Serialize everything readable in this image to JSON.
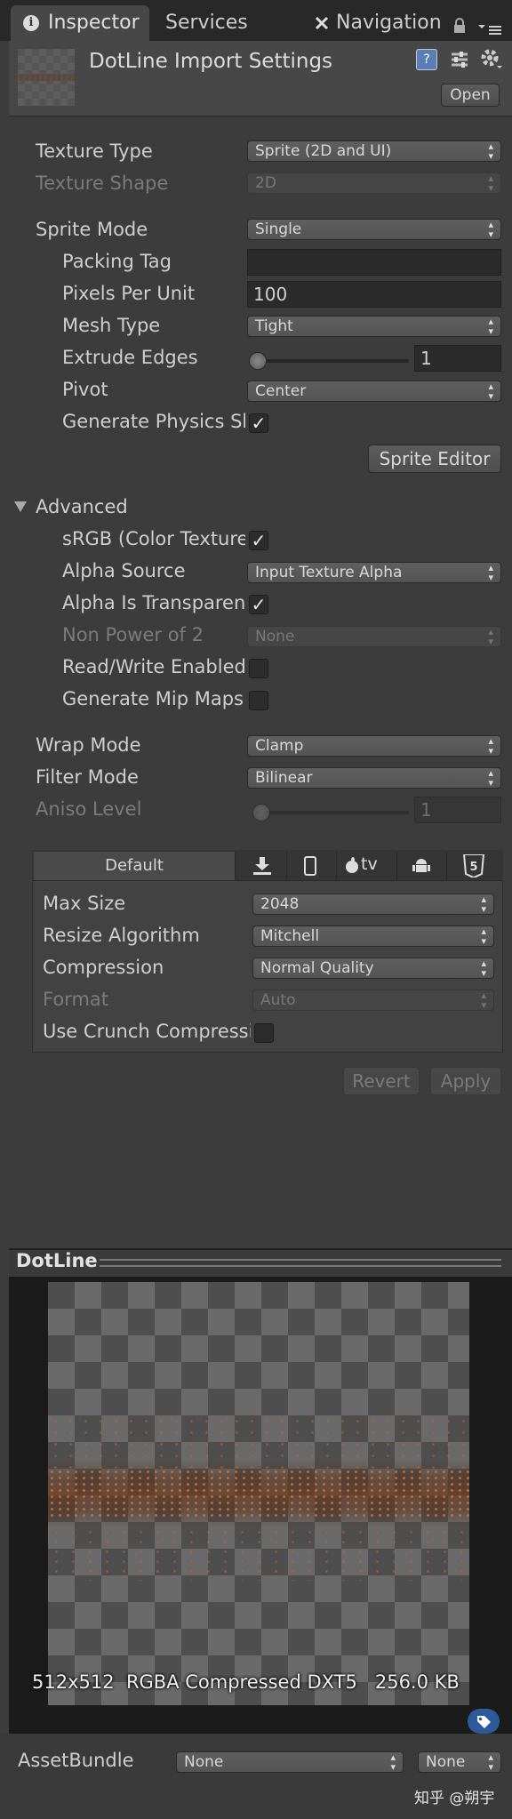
{
  "tabs": {
    "inspector": "Inspector",
    "services": "Services",
    "navigation": "Navigation"
  },
  "header": {
    "title": "DotLine Import Settings",
    "open_button": "Open"
  },
  "settings": {
    "texture_type": {
      "label": "Texture Type",
      "value": "Sprite (2D and UI)"
    },
    "texture_shape": {
      "label": "Texture Shape",
      "value": "2D"
    },
    "sprite_mode": {
      "label": "Sprite Mode",
      "value": "Single"
    },
    "packing_tag": {
      "label": "Packing Tag",
      "value": ""
    },
    "pixels_per_unit": {
      "label": "Pixels Per Unit",
      "value": "100"
    },
    "mesh_type": {
      "label": "Mesh Type",
      "value": "Tight"
    },
    "extrude_edges": {
      "label": "Extrude Edges",
      "value": "1",
      "slider_fraction": 0
    },
    "pivot": {
      "label": "Pivot",
      "value": "Center"
    },
    "generate_physics": {
      "label": "Generate Physics Shape",
      "checked": true
    },
    "sprite_editor_button": "Sprite Editor"
  },
  "advanced": {
    "label": "Advanced",
    "srgb": {
      "label": "sRGB (Color Texture)",
      "checked": true
    },
    "alpha_source": {
      "label": "Alpha Source",
      "value": "Input Texture Alpha"
    },
    "alpha_is_transparency": {
      "label": "Alpha Is Transparency",
      "checked": true
    },
    "non_power_of_2": {
      "label": "Non Power of 2",
      "value": "None"
    },
    "read_write": {
      "label": "Read/Write Enabled",
      "checked": false
    },
    "mip_maps": {
      "label": "Generate Mip Maps",
      "checked": false
    }
  },
  "wrap_mode": {
    "label": "Wrap Mode",
    "value": "Clamp"
  },
  "filter_mode": {
    "label": "Filter Mode",
    "value": "Bilinear"
  },
  "aniso_level": {
    "label": "Aniso Level",
    "value": "1",
    "slider_fraction": 0
  },
  "platform": {
    "default_tab": "Default",
    "tv_label": "tv",
    "max_size": {
      "label": "Max Size",
      "value": "2048"
    },
    "resize_algorithm": {
      "label": "Resize Algorithm",
      "value": "Mitchell"
    },
    "compression": {
      "label": "Compression",
      "value": "Normal Quality"
    },
    "format": {
      "label": "Format",
      "value": "Auto"
    },
    "use_crunch": {
      "label": "Use Crunch Compression",
      "checked": false
    }
  },
  "actions": {
    "revert": "Revert",
    "apply": "Apply"
  },
  "preview": {
    "title": "DotLine",
    "info": "512x512  RGBA Compressed DXT5   256.0 KB"
  },
  "asset_bundle": {
    "label": "AssetBundle",
    "name_value": "None",
    "variant_value": "None"
  },
  "watermark": "知乎 @朔宇",
  "colors": {
    "panel_bg": "#3c3c3c",
    "tab_active": "#474747",
    "accent_orange": "#c8602a"
  }
}
